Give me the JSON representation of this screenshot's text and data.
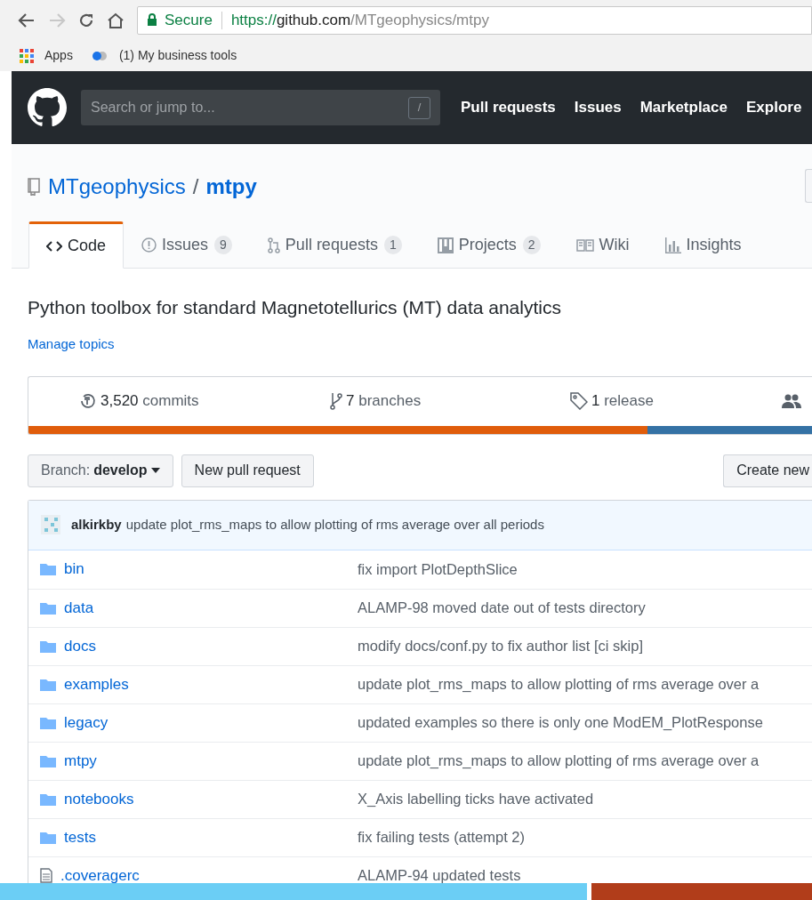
{
  "browser": {
    "security": "Secure",
    "url_scheme": "https://",
    "url_host": "github.com",
    "url_path": "/MTgeophysics/mtpy",
    "bookmarks": [
      {
        "kind": "apps",
        "label": "Apps"
      },
      {
        "kind": "site",
        "label": "(1) My business tools"
      }
    ]
  },
  "header": {
    "search_placeholder": "Search or jump to...",
    "shortcut": "/",
    "nav": [
      "Pull requests",
      "Issues",
      "Marketplace",
      "Explore"
    ]
  },
  "repo": {
    "owner": "MTgeophysics",
    "separator": "/",
    "name": "mtpy"
  },
  "tabs": [
    {
      "kind": "code",
      "label": "Code",
      "selected": true
    },
    {
      "kind": "issues",
      "label": "Issues",
      "count": "9",
      "selected": false
    },
    {
      "kind": "pulls",
      "label": "Pull requests",
      "count": "1",
      "selected": false
    },
    {
      "kind": "projects",
      "label": "Projects",
      "count": "2",
      "selected": false
    },
    {
      "kind": "wiki",
      "label": "Wiki",
      "selected": false
    },
    {
      "kind": "insights",
      "label": "Insights",
      "selected": false
    }
  ],
  "description": "Python toolbox for standard Magnetotellurics (MT) data analytics",
  "manage_topics": "Manage topics",
  "stats": [
    {
      "kind": "commits",
      "number": "3,520",
      "label": "commits"
    },
    {
      "kind": "branches",
      "number": "7",
      "label": "branches"
    },
    {
      "kind": "releases",
      "number": "1",
      "label": "release"
    },
    {
      "kind": "contributors"
    }
  ],
  "languages": [
    {
      "color": "#e05d0b",
      "level": 0.79
    },
    {
      "color": "#3572a5",
      "level": 0.21
    }
  ],
  "branch": {
    "label": "Branch:",
    "value": "develop"
  },
  "buttons": [
    "New pull request",
    "Create new"
  ],
  "latest_commit": {
    "author": "alkirkby",
    "message": "update plot_rms_maps to allow plotting of rms average over all periods"
  },
  "files": [
    {
      "kind": "dir",
      "name": "bin",
      "message": "fix import PlotDepthSlice"
    },
    {
      "kind": "dir",
      "name": "data",
      "message": "ALAMP-98 moved date out of tests directory"
    },
    {
      "kind": "dir",
      "name": "docs",
      "message": "modify docs/conf.py to fix author list [ci skip]"
    },
    {
      "kind": "dir",
      "name": "examples",
      "message": "update plot_rms_maps to allow plotting of rms average over a"
    },
    {
      "kind": "dir",
      "name": "legacy",
      "message": "updated examples so there is only one ModEM_PlotResponse"
    },
    {
      "kind": "dir",
      "name": "mtpy",
      "message": "update plot_rms_maps to allow plotting of rms average over a"
    },
    {
      "kind": "dir",
      "name": "notebooks",
      "message": "X_Axis labelling ticks have activated"
    },
    {
      "kind": "dir",
      "name": "tests",
      "message": "fix failing tests (attempt 2)"
    },
    {
      "kind": "file",
      "name": ".coveragerc",
      "message": "ALAMP-94 updated tests"
    }
  ]
}
